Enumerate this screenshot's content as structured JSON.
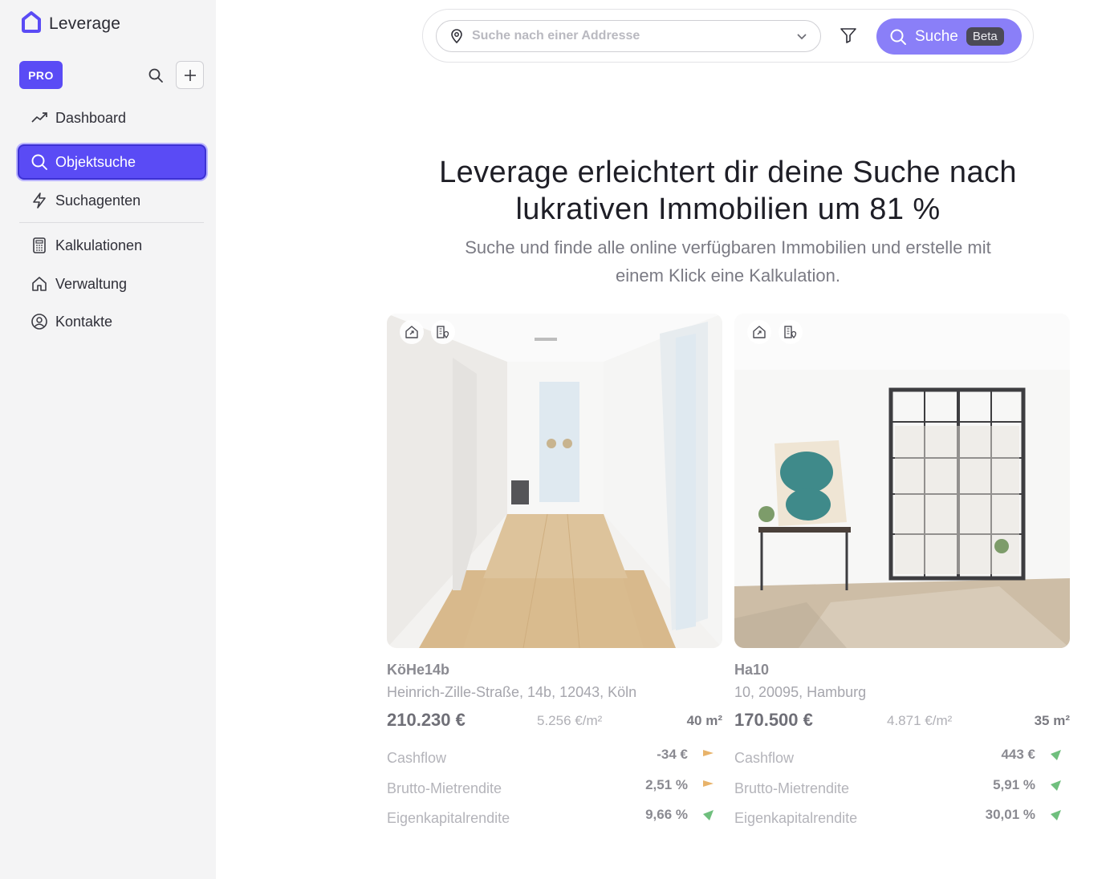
{
  "app": {
    "name": "Leverage"
  },
  "sidebar": {
    "plan_badge": "PRO",
    "items": [
      {
        "label": "Dashboard",
        "icon": "trend-icon"
      },
      {
        "label": "Objektsuche",
        "icon": "search-icon",
        "active": true
      },
      {
        "label": "Suchagenten",
        "icon": "lightning-icon"
      },
      {
        "label": "Kalkulationen",
        "icon": "calculator-icon"
      },
      {
        "label": "Verwaltung",
        "icon": "home-icon"
      },
      {
        "label": "Kontakte",
        "icon": "user-circle-icon"
      }
    ]
  },
  "search": {
    "placeholder": "Suche nach einer Addresse",
    "button_label": "Suche",
    "beta_badge": "Beta"
  },
  "hero": {
    "title_line1": "Leverage erleichtert dir deine Suche nach",
    "title_line2": "lukrativen Immobilien um 81 %",
    "subtitle_line1": "Suche und finde alle online verfügbaren Immobilien und erstelle mit",
    "subtitle_line2": "einem Klick eine Kalkulation."
  },
  "colors": {
    "accent": "#5a4bf5",
    "accent_light": "#8a7ff8",
    "indicator_orange": "#e8b36a",
    "indicator_green": "#6fbf7d"
  },
  "listings": [
    {
      "name": "KöHe14b",
      "address": "Heinrich-Zille-Straße, 14b, 12043, Köln",
      "price": "210.230 €",
      "price_per_sqm": "5.256 €/m²",
      "area": "40 m²",
      "metrics": [
        {
          "label": "Cashflow",
          "value": "-34 €",
          "indicator": "neutral"
        },
        {
          "label": "Brutto-Mietrendite",
          "value": "2,51 %",
          "indicator": "neutral"
        },
        {
          "label": "Eigenkapitalrendite",
          "value": "9,66 %",
          "indicator": "up"
        }
      ]
    },
    {
      "name": "Ha10",
      "address": "10, 20095, Hamburg",
      "price": "170.500 €",
      "price_per_sqm": "4.871 €/m²",
      "area": "35 m²",
      "metrics": [
        {
          "label": "Cashflow",
          "value": "443 €",
          "indicator": "up"
        },
        {
          "label": "Brutto-Mietrendite",
          "value": "5,91 %",
          "indicator": "up"
        },
        {
          "label": "Eigenkapitalrendite",
          "value": "30,01 %",
          "indicator": "up"
        }
      ]
    }
  ]
}
